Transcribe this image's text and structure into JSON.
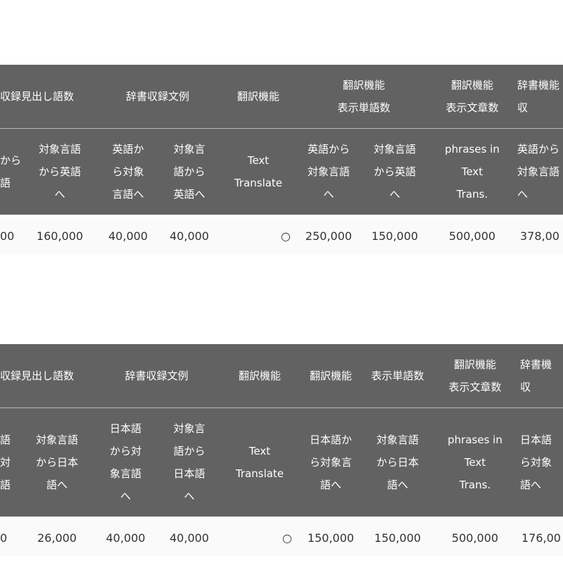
{
  "tables": [
    {
      "id": "english",
      "group_headers": [
        "収録見出し語数",
        "辞書収録文例",
        "翻訳機能",
        "翻訳機能\n表示単語数",
        "翻訳機能\n表示文章数",
        "辞書機能\n収"
      ],
      "sub_headers": [
        "から\n語",
        "対象言語\nから英語\nへ",
        "英語か\nら対象\n言語へ",
        "対象言\n語から\n英語へ",
        "Text\nTranslate",
        "英語から\n対象言語\nへ",
        "対象言語\nから英語\nへ",
        "phrases in\nText\nTrans.",
        "英語から\n対象言語\nへ"
      ],
      "values": [
        "00",
        "160,000",
        "40,000",
        "40,000",
        "○",
        "250,000",
        "150,000",
        "500,000",
        "378,00"
      ]
    },
    {
      "id": "japanese",
      "group_headers": [
        "収録見出し語数",
        "辞書収録文例",
        "翻訳機能",
        "翻訳機能",
        "表示単語数",
        "翻訳機能\n表示文章数",
        "辞書機\n収"
      ],
      "sub_headers": [
        "語\n対\n語",
        "対象言語\nから日本\n語へ",
        "日本語\nから対\n象言語\nへ",
        "対象言\n語から\n日本語\nへ",
        "Text\nTranslate",
        "日本語か\nら対象言\n語へ",
        "対象言語\nから日本\n語へ",
        "phrases in\nText\nTrans.",
        "日本語\nら対象\n語へ"
      ],
      "values": [
        "0",
        "26,000",
        "40,000",
        "40,000",
        "○",
        "150,000",
        "150,000",
        "500,000",
        "176,00"
      ]
    }
  ]
}
